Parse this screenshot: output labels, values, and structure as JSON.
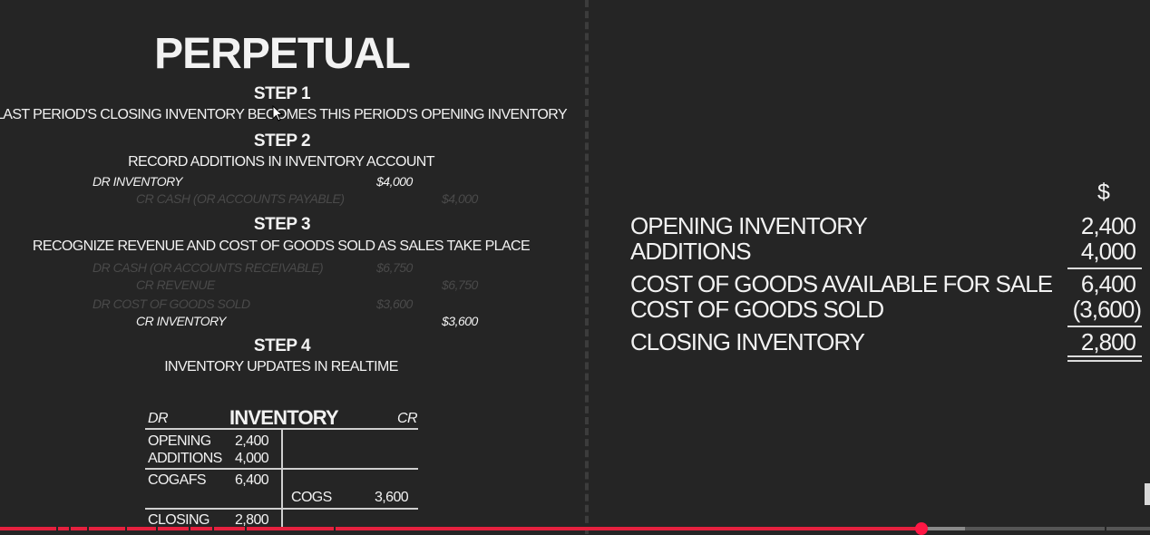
{
  "left": {
    "title": "PERPETUAL",
    "step1": {
      "heading": "STEP 1",
      "desc": "LAST PERIOD'S CLOSING INVENTORY BECOMES THIS PERIOD'S OPENING INVENTORY"
    },
    "step2": {
      "heading": "STEP 2",
      "desc": "RECORD ADDITIONS IN INVENTORY ACCOUNT",
      "dr_label": "DR INVENTORY",
      "dr_amount": "$4,000",
      "cr_label": "CR CASH (OR ACCOUNTS PAYABLE)",
      "cr_amount": "$4,000"
    },
    "step3": {
      "heading": "STEP 3",
      "desc": "RECOGNIZE REVENUE AND COST OF GOODS SOLD AS SALES TAKE PLACE",
      "e1_label": "DR CASH (OR ACCOUNTS RECEIVABLE)",
      "e1_amount": "$6,750",
      "e2_label": "CR REVENUE",
      "e2_amount": "$6,750",
      "e3_label": "DR COST OF GOODS SOLD",
      "e3_amount": "$3,600",
      "e4_label": "CR INVENTORY",
      "e4_amount": "$3,600"
    },
    "step4": {
      "heading": "STEP 4",
      "desc": "INVENTORY UPDATES IN REALTIME"
    },
    "taccount": {
      "dr": "DR",
      "title": "INVENTORY",
      "cr": "CR",
      "opening_label": "OPENING",
      "opening_value": "2,400",
      "additions_label": "ADDITIONS",
      "additions_value": "4,000",
      "cogafs_label": "COGAFS",
      "cogafs_value": "6,400",
      "cogs_label": "COGS",
      "cogs_value": "3,600",
      "closing_label": "CLOSING",
      "closing_value": "2,800"
    }
  },
  "right": {
    "currency": "$",
    "rows": [
      {
        "label": "OPENING INVENTORY",
        "amount": "2,400"
      },
      {
        "label": "ADDITIONS",
        "amount": "4,000"
      },
      {
        "label": "COST OF GOODS AVAILABLE FOR SALE",
        "amount": "6,400"
      },
      {
        "label": "COST OF GOODS SOLD",
        "amount": "(3,600)"
      },
      {
        "label": "CLOSING INVENTORY",
        "amount": "2,800"
      }
    ]
  },
  "player": {
    "progress_fraction": 0.801,
    "buffered_fraction": 0.839,
    "accent_color": "#e5203e"
  }
}
